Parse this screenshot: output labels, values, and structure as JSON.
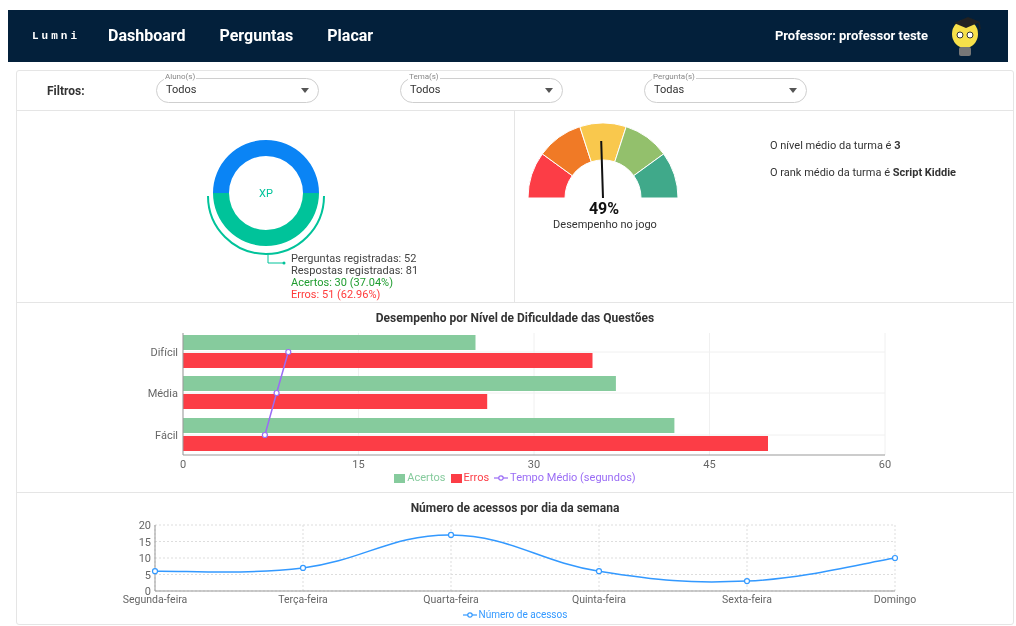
{
  "header": {
    "logo": "Lumni",
    "nav": [
      {
        "label": "Dashboard"
      },
      {
        "label": "Perguntas"
      },
      {
        "label": "Placar"
      }
    ],
    "user": "Professor: professor teste"
  },
  "filters": {
    "label": "Filtros:",
    "selects": [
      {
        "label": "Aluno(s)",
        "value": "Todos"
      },
      {
        "label": "Tema(s)",
        "value": "Todos"
      },
      {
        "label": "Pergunta(s)",
        "value": "Todas"
      }
    ]
  },
  "xp_summary": {
    "center_label": "XP",
    "lines": [
      {
        "text": "Perguntas registradas: 52",
        "kind": "neutral"
      },
      {
        "text": "Respostas registradas: 81",
        "kind": "neutral"
      },
      {
        "text": "Acertos: 30 (37.04%)",
        "kind": "success"
      },
      {
        "text": "Erros: 51 (62.96%)",
        "kind": "error"
      }
    ]
  },
  "gauge": {
    "reading": "49%",
    "caption": "Desempenho no jogo"
  },
  "class_stats": [
    "O nível médio da turma é **3**",
    "O rank médio da turma é **Script Kiddie**"
  ],
  "difficulty_chart": {
    "chart_data": {
      "type": "bar",
      "orientation": "horizontal",
      "title": "Desempenho por Nível de Dificuldade das Questões",
      "categories": [
        "Difícil",
        "Média",
        "Fácil"
      ],
      "series": [
        {
          "name": "Acertos",
          "color": "#86cb9d",
          "type": "bar",
          "values": [
            25,
            37,
            42
          ]
        },
        {
          "name": "Erros",
          "color": "#fc3d46",
          "type": "bar",
          "values": [
            35,
            26,
            50
          ]
        },
        {
          "name": "Tempo Médio (segundos)",
          "color": "#9a6cf5",
          "type": "line",
          "marker": "circle",
          "values": [
            9,
            8,
            7
          ]
        }
      ],
      "xlim": [
        0,
        60
      ],
      "xticks": [
        0,
        15,
        30,
        45,
        60
      ],
      "grid": true
    }
  },
  "access_chart": {
    "chart_data": {
      "type": "line",
      "title": "Número de acessos por dia da semana",
      "categories": [
        "Segunda-feira",
        "Terça-feira",
        "Quarta-feira",
        "Quinta-feira",
        "Sexta-feira",
        "Domingo"
      ],
      "series": [
        {
          "name": "Número de acessos",
          "color": "#3399ff",
          "marker": "circle",
          "values": [
            6,
            7,
            17,
            6,
            3,
            10
          ]
        }
      ],
      "ylim": [
        0,
        20
      ],
      "yticks": [
        0,
        5,
        10,
        15,
        20
      ],
      "grid": true
    }
  }
}
